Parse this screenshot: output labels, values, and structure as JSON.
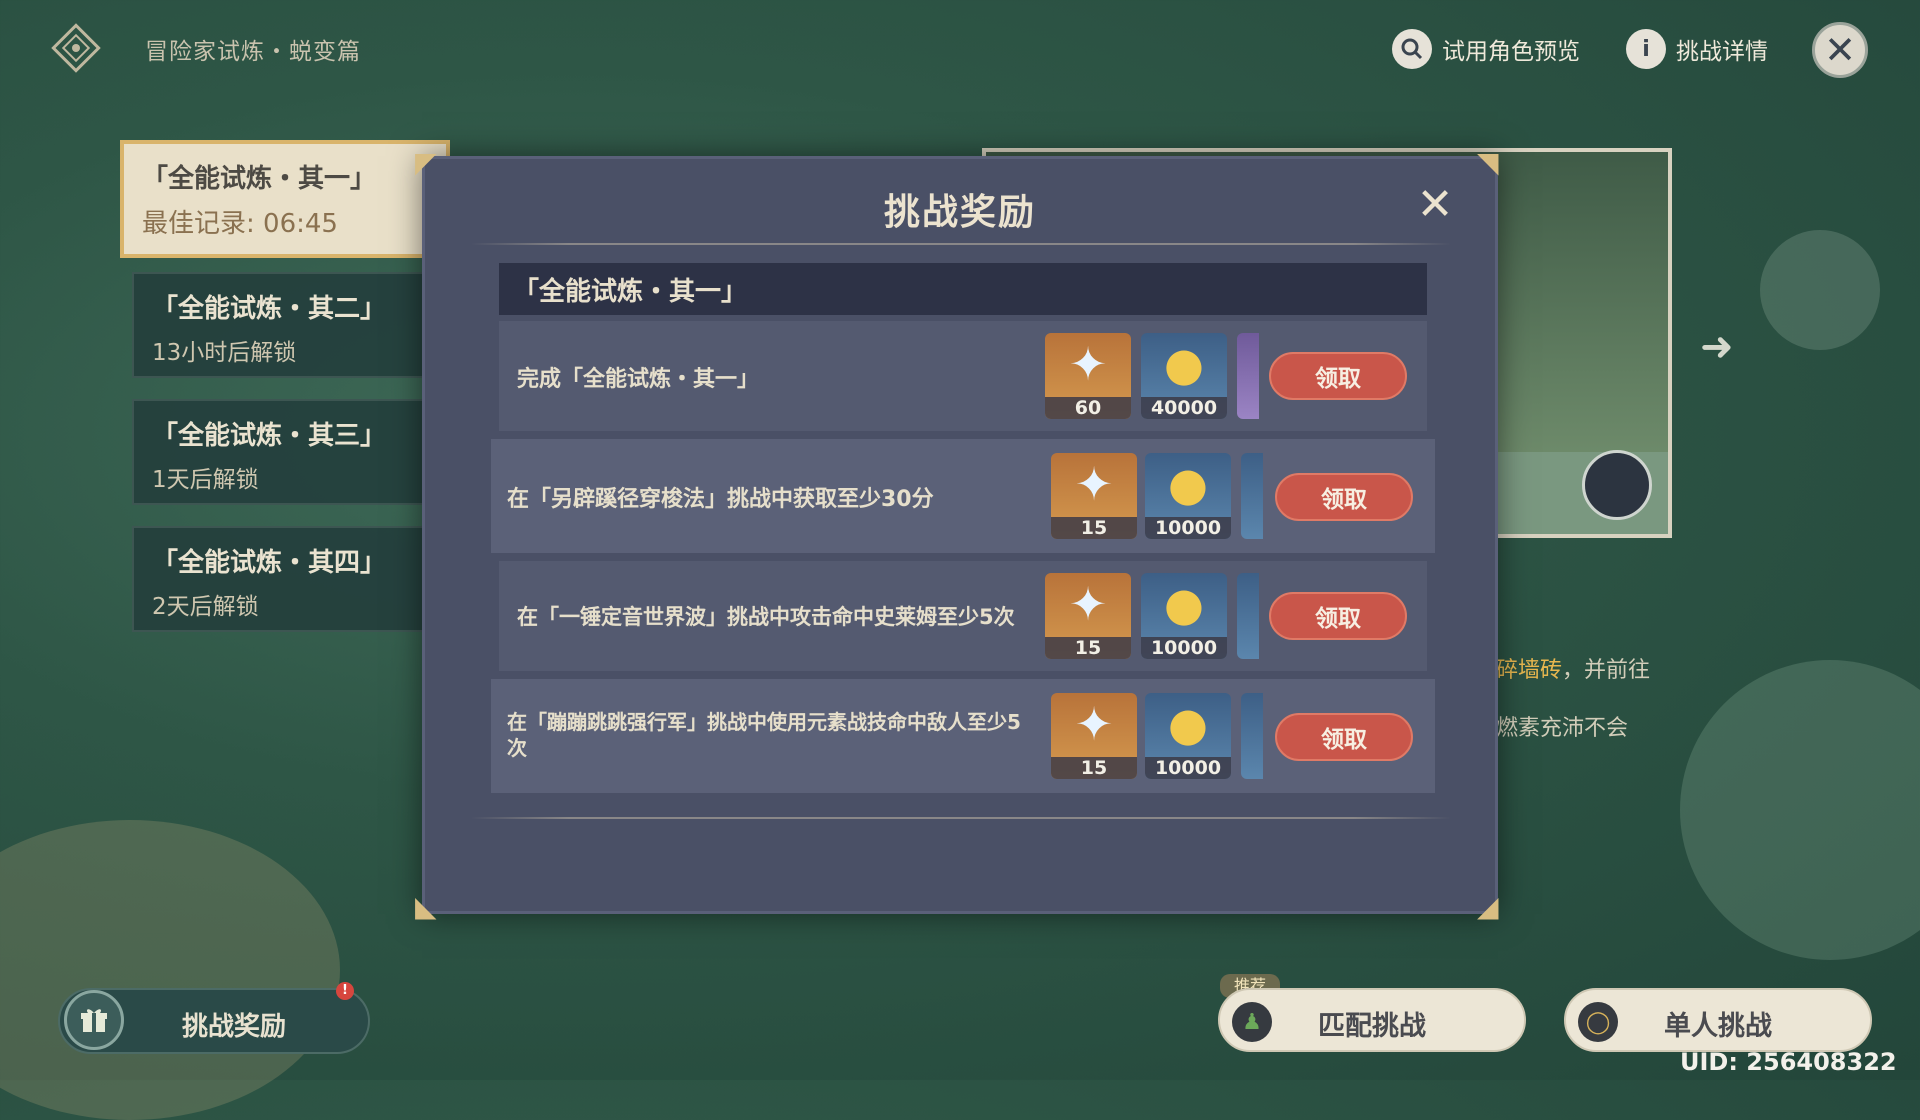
{
  "header": {
    "event_title": "冒险家试炼・蜕变篇",
    "trial_preview_label": "试用角色预览",
    "challenge_detail_label": "挑战详情"
  },
  "trials": [
    {
      "name": "「全能试炼・其一」",
      "status": "最佳记录: 06:45",
      "active": true
    },
    {
      "name": "「全能试炼・其二」",
      "status": "13小时后解锁",
      "active": false
    },
    {
      "name": "「全能试炼・其三」",
      "status": "1天后解锁",
      "active": false
    },
    {
      "name": "「全能试炼・其四」",
      "status": "2天后解锁",
      "active": false
    }
  ],
  "description": {
    "line1_highlight": "碎墙砖",
    "line1_rest": "，并前往",
    "line2": "燃素充沛不会"
  },
  "modal": {
    "title": "挑战奖励",
    "section_title": "「全能试炼・其一」",
    "claim_label": "领取",
    "rows": [
      {
        "text": "完成「全能试炼・其一」",
        "primogems": "60",
        "mora": "40000"
      },
      {
        "text": "在「另辟蹊径穿梭法」挑战中获取至少30分",
        "primogems": "15",
        "mora": "10000"
      },
      {
        "text": "在「一锤定音世界波」挑战中攻击命中史莱姆至少5次",
        "primogems": "15",
        "mora": "10000"
      },
      {
        "text": "在「蹦蹦跳跳强行军」挑战中使用元素战技命中敌人至少5次",
        "primogems": "15",
        "mora": "10000"
      }
    ]
  },
  "bottom": {
    "rewards_label": "挑战奖励",
    "reward_badge": "!",
    "recommend_tag": "推荐",
    "match_label": "匹配挑战",
    "solo_label": "单人挑战",
    "uid": "UID: 256408322"
  },
  "colors": {
    "claim_button": "#c9564a",
    "modal_bg": "#4a5066",
    "highlight": "#e8b74f"
  }
}
